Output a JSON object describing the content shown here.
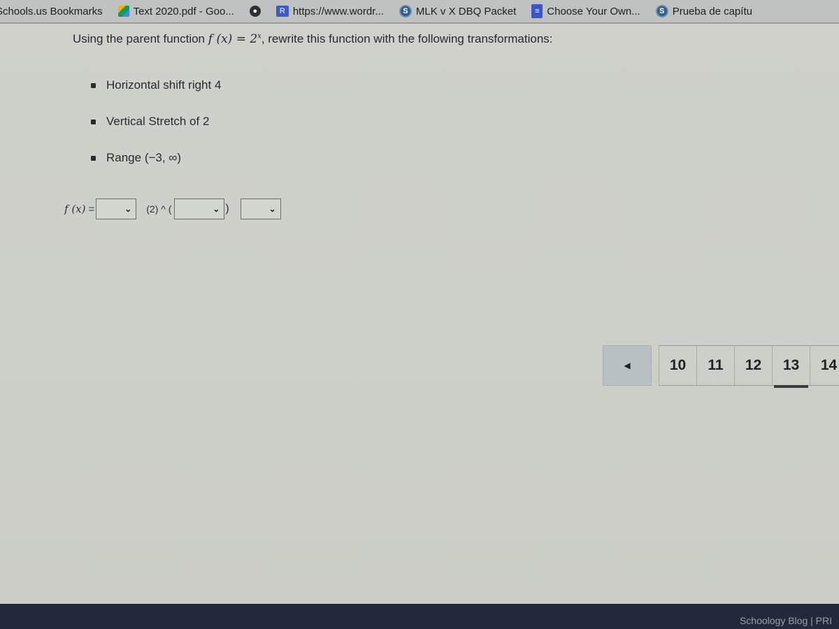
{
  "bookmarks_bar": {
    "items": [
      {
        "label": "Schools.us Bookmarks",
        "icon": "none"
      },
      {
        "label": "Text 2020.pdf - Goo...",
        "icon": "google-drive-icon"
      },
      {
        "label": "",
        "icon": "globe-icon"
      },
      {
        "label": "https://www.wordr...",
        "icon": "wordreference-icon"
      },
      {
        "label": "MLK v X DBQ Packet",
        "icon": "s-circle-icon"
      },
      {
        "label": "Choose Your Own...",
        "icon": "google-docs-icon"
      },
      {
        "label": "Prueba de capítu",
        "icon": "s-circle-icon"
      }
    ]
  },
  "question": {
    "prompt_before": "Using the parent function",
    "prompt_math": "f (x) = 2",
    "prompt_exponent": "x",
    "prompt_after": ", rewrite this function with the following transformations:",
    "transformations": [
      "Horizontal shift right 4",
      "Vertical Stretch of 2",
      "Range (−3, ∞)"
    ],
    "answer": {
      "lhs": "f (x)",
      "equals": "=",
      "base_text": "(2) ^ (",
      "close_paren": ")",
      "dropdowns": [
        {
          "selected": ""
        },
        {
          "selected": ""
        },
        {
          "selected": ""
        }
      ]
    }
  },
  "pagination": {
    "prev_icon": "◀",
    "pages": [
      "10",
      "11",
      "12",
      "13",
      "14"
    ],
    "current": "13"
  },
  "footer": {
    "links_text": "Schoology Blog  |  PRI"
  }
}
